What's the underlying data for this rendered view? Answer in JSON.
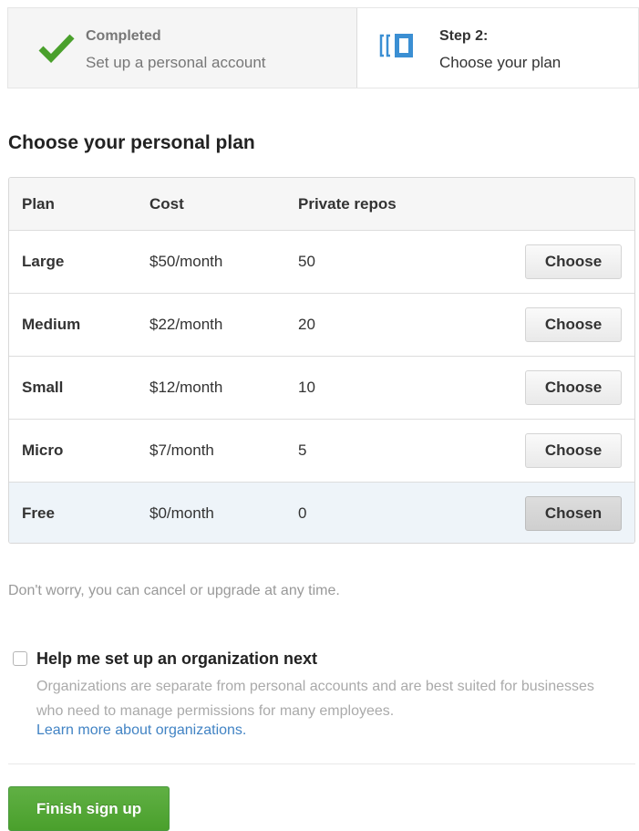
{
  "steps": {
    "completed": {
      "title": "Completed",
      "desc": "Set up a personal account",
      "icon": "checkmark-icon",
      "icon_color": "#4aa02c"
    },
    "current": {
      "title": "Step 2:",
      "desc": "Choose your plan",
      "icon": "plan-icon",
      "icon_color": "#3b8fd3"
    }
  },
  "heading": "Choose your personal plan",
  "table": {
    "headers": {
      "plan": "Plan",
      "cost": "Cost",
      "repos": "Private repos"
    },
    "rows": [
      {
        "plan": "Large",
        "cost": "$50/month",
        "repos": "50",
        "button": "Choose",
        "chosen": false
      },
      {
        "plan": "Medium",
        "cost": "$22/month",
        "repos": "20",
        "button": "Choose",
        "chosen": false
      },
      {
        "plan": "Small",
        "cost": "$12/month",
        "repos": "10",
        "button": "Choose",
        "chosen": false
      },
      {
        "plan": "Micro",
        "cost": "$7/month",
        "repos": "5",
        "button": "Choose",
        "chosen": false
      },
      {
        "plan": "Free",
        "cost": "$0/month",
        "repos": "0",
        "button": "Chosen",
        "chosen": true
      }
    ]
  },
  "note": "Don't worry, you can cancel or upgrade at any time.",
  "organization": {
    "checked": false,
    "title": "Help me set up an organization next",
    "desc": "Organizations are separate from personal accounts and are best suited for businesses who need to manage permissions for many employees.",
    "link": "Learn more about organizations."
  },
  "finish_button": "Finish sign up",
  "colors": {
    "accent_green": "#55a838",
    "link_blue": "#4183c4",
    "chosen_row": "#eef4f9"
  }
}
